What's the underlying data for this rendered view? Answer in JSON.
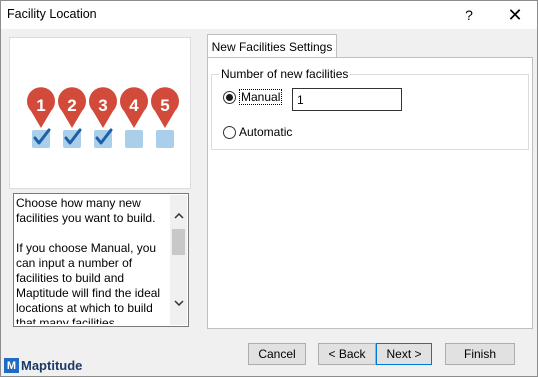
{
  "window": {
    "title": "Facility Location",
    "help_glyph": "?",
    "close_glyph": "✕"
  },
  "illustration": {
    "markers": [
      {
        "number": "1",
        "checked": true
      },
      {
        "number": "2",
        "checked": true
      },
      {
        "number": "3",
        "checked": true
      },
      {
        "number": "4",
        "checked": false
      },
      {
        "number": "5",
        "checked": false
      }
    ],
    "colors": {
      "pin": "#d24a3a",
      "checkbox": "#a9cfea",
      "check": "#1d5fa8"
    }
  },
  "info_text": "Choose how many new facilities you want to build.\n\nIf you choose Manual, you can input a number of facilities to build and Maptitude will find the ideal locations at which to build that many facilities",
  "tab": {
    "label": "New Facilities Settings"
  },
  "group": {
    "label": "Number of new facilities",
    "manual_label": "Manual",
    "manual_selected": true,
    "automatic_label": "Automatic",
    "automatic_selected": false,
    "count_value": "1"
  },
  "footer": {
    "logo_text": "Maptitude",
    "cancel_label": "Cancel",
    "back_label": "< Back",
    "next_label": "Next >",
    "finish_label": "Finish"
  }
}
